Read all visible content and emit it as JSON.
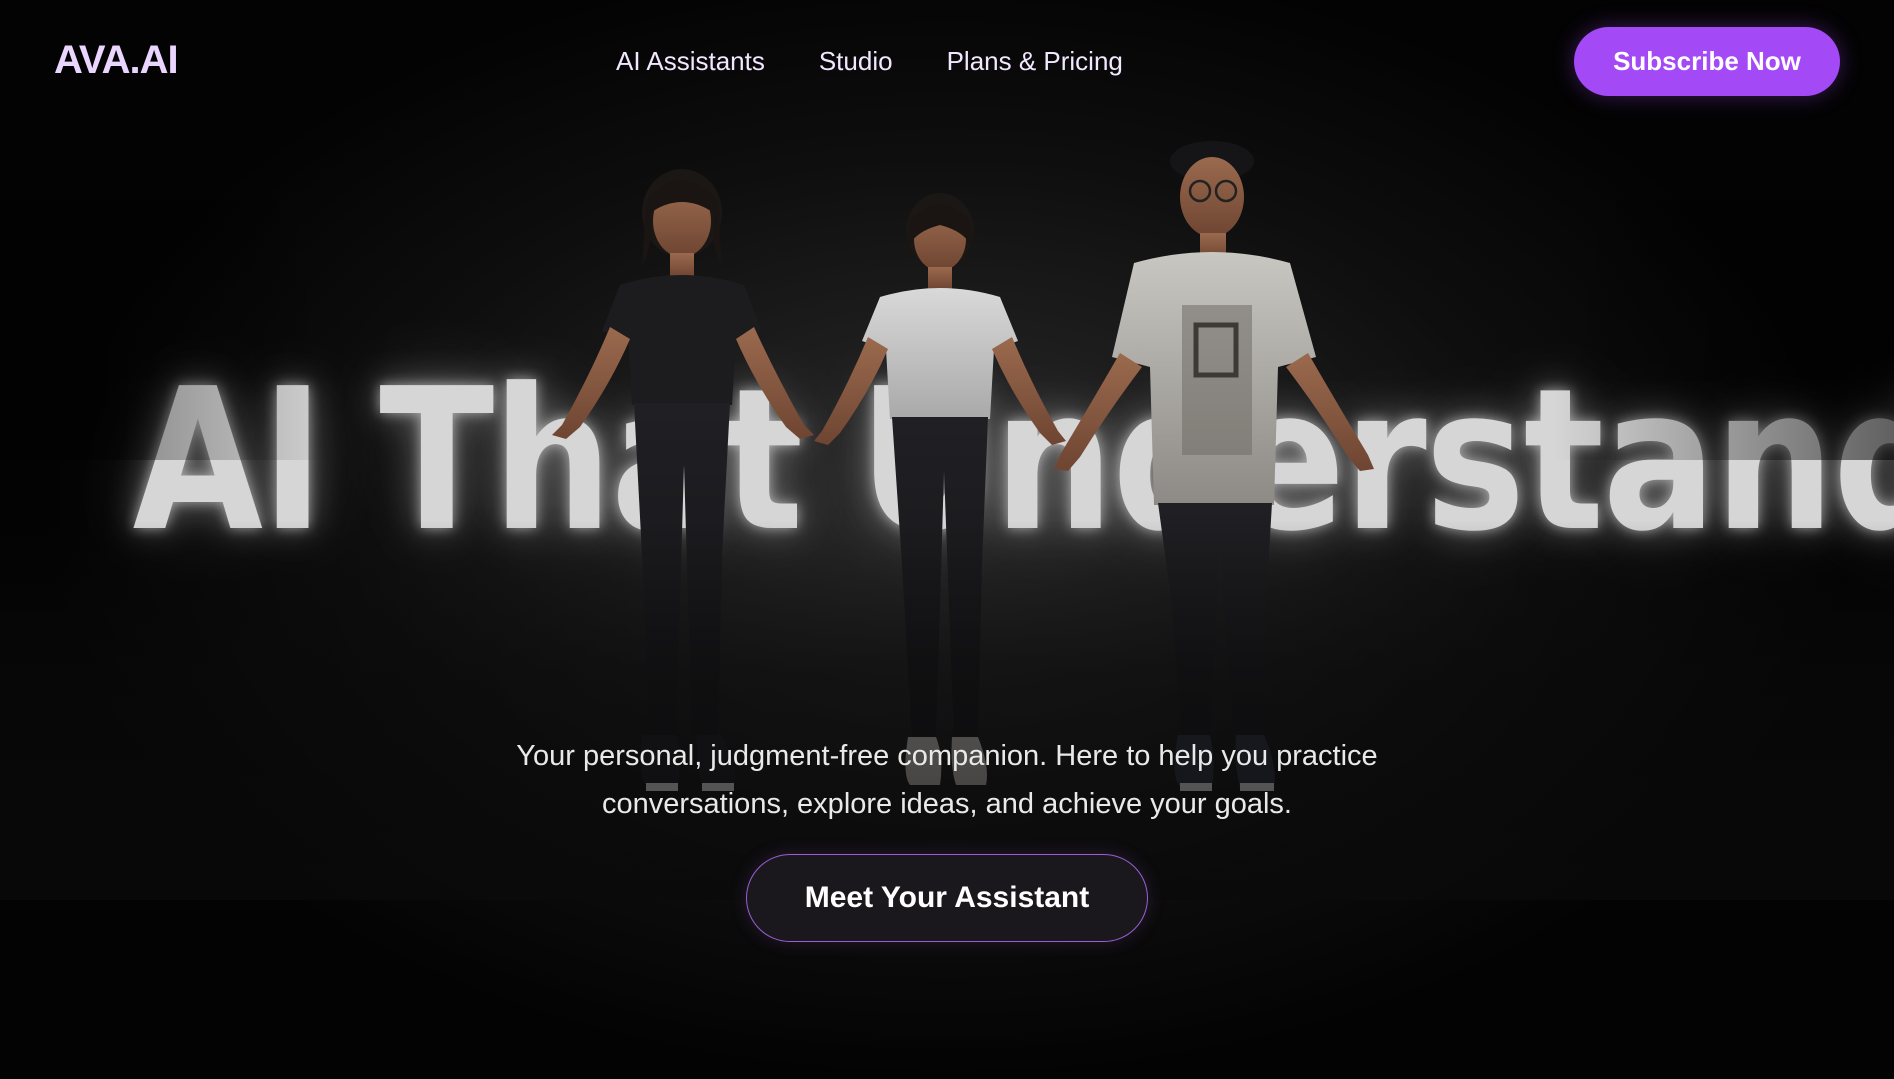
{
  "header": {
    "logo": "AVA.AI",
    "nav": [
      {
        "label": "AI Assistants"
      },
      {
        "label": "Studio"
      },
      {
        "label": "Plans & Pricing"
      }
    ],
    "subscribe_label": "Subscribe Now"
  },
  "hero": {
    "title": "AI That Understands You",
    "subtitle_line1": "Your personal, judgment-free companion. Here to help you practice",
    "subtitle_line2": "conversations, explore ideas, and achieve your goals.",
    "cta_label": "Meet Your Assistant",
    "avatars": [
      {
        "name": "avatar-left",
        "shirt": "black t-shirt"
      },
      {
        "name": "avatar-center",
        "shirt": "white t-shirt"
      },
      {
        "name": "avatar-right",
        "shirt": "graphic t-shirt, cap, glasses"
      }
    ]
  },
  "colors": {
    "accent": "#a349f5",
    "logo": "#ead5ff",
    "background": "#000000",
    "cta_border": "#9a5fd6"
  }
}
